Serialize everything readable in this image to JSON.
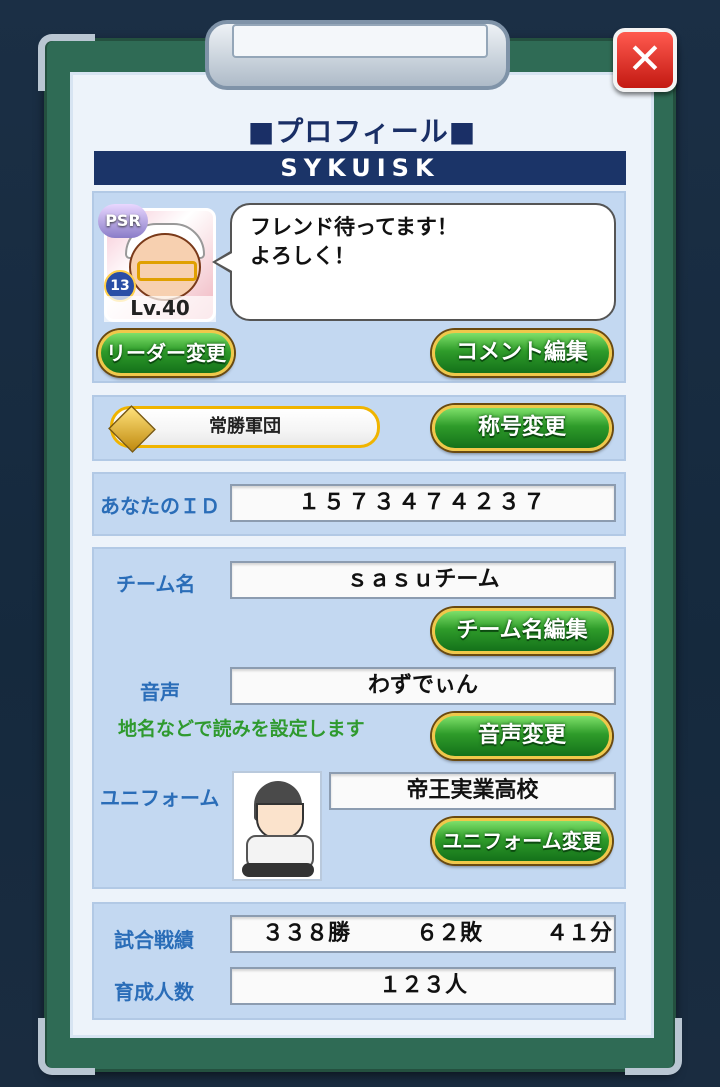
{
  "window": {
    "title": "■プロフィール■",
    "close_icon": "close-icon"
  },
  "profile": {
    "player_name": "SYKUISK",
    "rank_badge": "PSR",
    "rank_number": "13",
    "level": "Lv.40",
    "comment": "フレンド待ってます！\nよろしく！",
    "leader_change_label": "リーダー変更",
    "comment_edit_label": "コメント編集"
  },
  "title_section": {
    "current_title": "常勝軍団",
    "change_title_label": "称号変更"
  },
  "id_section": {
    "label": "あなたのＩＤ",
    "value": "１５７３４７４２３７"
  },
  "team_section": {
    "team_name_label": "チーム名",
    "team_name_value": "ｓａｓｕチーム",
    "team_name_edit_label": "チーム名編集",
    "voice_label": "音声",
    "voice_value": "わずでぃん",
    "voice_hint": "地名などで読みを設定します",
    "voice_change_label": "音声変更",
    "uniform_label": "ユニフォーム",
    "uniform_value": "帝王実業高校",
    "uniform_change_label": "ユニフォーム変更"
  },
  "stats_section": {
    "record_label": "試合戦績",
    "wins": "３３８勝",
    "losses": "６２敗",
    "draws": "４１分",
    "trained_label": "育成人数",
    "trained_value": "１２３人"
  },
  "colors": {
    "accent_green": "#2f9c2a",
    "header_navy": "#1b3468",
    "label_blue": "#2a6db8"
  }
}
